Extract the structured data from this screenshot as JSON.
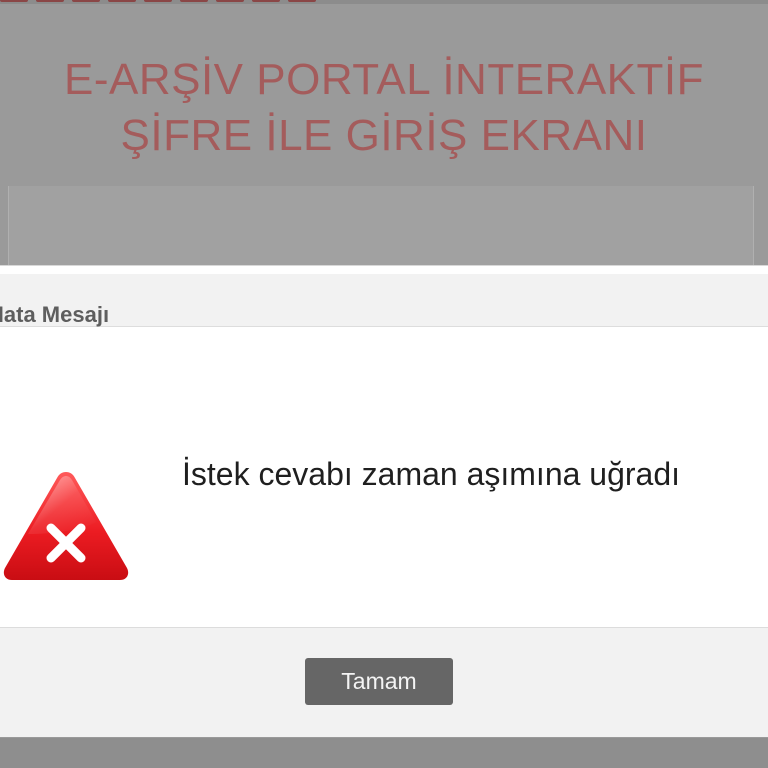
{
  "background_page": {
    "title_line_1": "E-ARŞİV PORTAL İNTERAKTİF",
    "title_line_2": "ŞİFRE İLE GİRİŞ EKRANI"
  },
  "dialog": {
    "title": "Hata Mesajı",
    "message": "İstek cevabı zaman aşımına uğradı",
    "icon": "error-warning-triangle-icon",
    "ok_button_label": "Tamam"
  },
  "colors": {
    "overlay_background": "#9a9a9a",
    "background_title": "#a45c5c",
    "icon_red": "#e8141b",
    "button_background": "#666666",
    "button_text": "#f4f4f4"
  }
}
